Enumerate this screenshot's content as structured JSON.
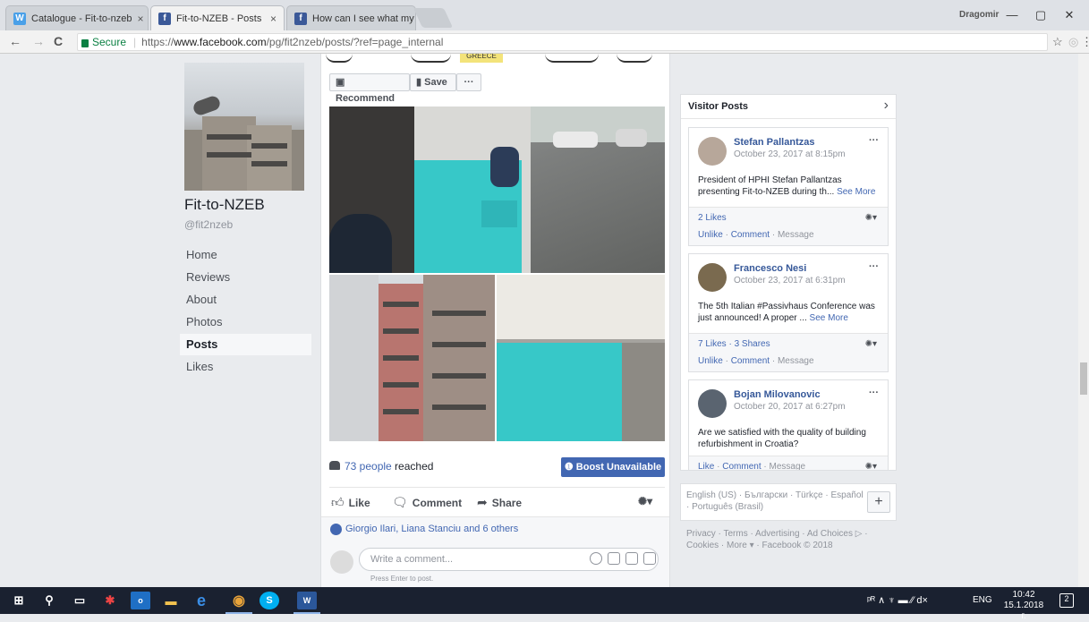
{
  "browser": {
    "tabs": [
      {
        "title": "Catalogue - Fit-to-nzeb",
        "favicon_color": "#4aa0e8",
        "favicon_glyph": "W"
      },
      {
        "title": "Fit-to-NZEB - Posts",
        "favicon_color": "#3b5998",
        "favicon_glyph": "f"
      },
      {
        "title": "How can I see what my ·",
        "favicon_color": "#3b5998",
        "favicon_glyph": "f"
      }
    ],
    "tab_close": "×",
    "user": "Dragomir",
    "window_controls": {
      "minimize": "—",
      "maximize": "▢",
      "close": "✕"
    },
    "nav": {
      "back": "←",
      "forward": "→",
      "reload": "C"
    },
    "secure_label": "Secure",
    "url_scheme": "https://",
    "url_host": "www.facebook.com",
    "url_path": "/pg/fit2nzeb/posts/?ref=page_internal",
    "star": "☆",
    "menu": "⋮"
  },
  "page": {
    "name": "Fit-to-NZEB",
    "handle": "@fit2nzeb",
    "nav": [
      {
        "label": "Home"
      },
      {
        "label": "Reviews"
      },
      {
        "label": "About"
      },
      {
        "label": "Photos"
      },
      {
        "label": "Posts",
        "active": true
      },
      {
        "label": "Likes"
      }
    ]
  },
  "post": {
    "map_label": "GREECE",
    "recommend_label": "Recommend",
    "save_label": "Save",
    "more_label": "···",
    "reach_count": "73 people",
    "reach_suffix": " reached",
    "boost_label": "Boost Unavailable",
    "actions": {
      "like": "Like",
      "comment": "Comment",
      "share": "Share",
      "reaction_menu": "▾"
    },
    "reactors": "Giorgio Ilari, Liana Stanciu and 6 others",
    "comment_placeholder": "Write a comment...",
    "comment_hint": "Press Enter to post."
  },
  "visitor_posts": {
    "title": "Visitor Posts",
    "chevron": "›",
    "items": [
      {
        "author": "Stefan Pallantzas",
        "date": "October 23, 2017 at 8:15pm",
        "text": "President of HPHI Stefan Pallantzas presenting Fit-to-NZEB during th...",
        "see_more": "See More",
        "stats": "2 Likes",
        "actions": [
          "Unlike",
          "Comment",
          "Message"
        ],
        "avatar_color": "#b7a79a"
      },
      {
        "author": "Francesco Nesi",
        "date": "October 23, 2017 at 6:31pm",
        "text": "The 5th Italian #Passivhaus Conference was just announced! A proper ...",
        "see_more": "See More",
        "stats": "7 Likes · 3 Shares",
        "actions": [
          "Unlike",
          "Comment",
          "Message"
        ],
        "avatar_color": "#7a6a4f"
      },
      {
        "author": "Bojan Milovanovic",
        "date": "October 20, 2017 at 6:27pm",
        "text": "Are we satisfied with the quality of building refurbishment in Croatia?",
        "see_more": "",
        "stats": "",
        "actions": [
          "Like",
          "Comment",
          "Message"
        ],
        "avatar_color": "#5a6470"
      }
    ],
    "more_label": "···",
    "separator": " · "
  },
  "languages": {
    "text": "English (US) · Български · Türkçe · Español · Português (Brasil)",
    "add": "+"
  },
  "footer": {
    "text": "Privacy · Terms · Advertising · Ad Choices ▷ · Cookies · More ▾ · Facebook © 2018"
  },
  "taskbar": {
    "lang": "ENG",
    "time": "10:42",
    "date": "15.1.2018 г.",
    "notifications": "2",
    "tray_icons": "ᵖᴿ  ∧  ♆  ▬  ⁄⁄  d×"
  },
  "colors": {
    "facebook_blue": "#4267b2",
    "teal_insulation": "#37c8c8",
    "taskbar": "#1a2130"
  }
}
